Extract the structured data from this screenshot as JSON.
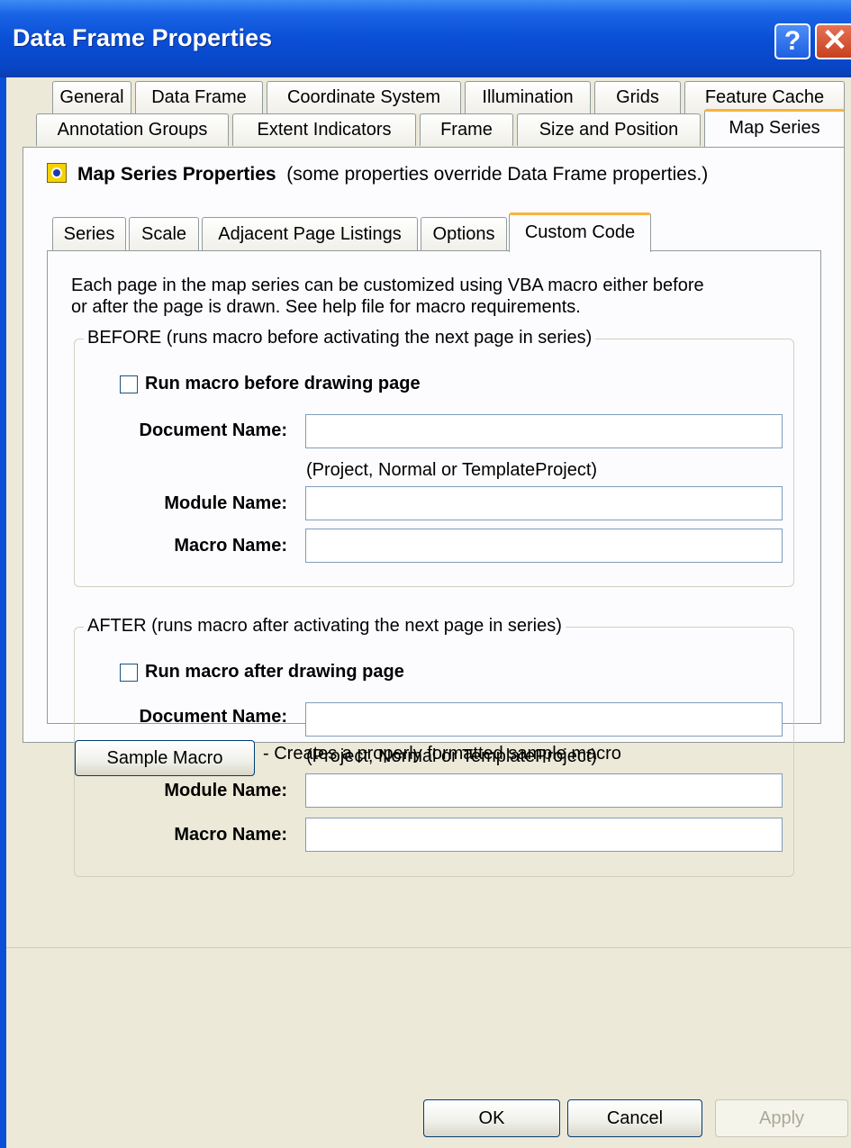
{
  "window": {
    "title": "Data Frame Properties",
    "help_glyph": "?",
    "close_glyph": "✕"
  },
  "outer_tabs": {
    "row1": [
      "General",
      "Data Frame",
      "Coordinate System",
      "Illumination",
      "Grids",
      "Feature Cache"
    ],
    "row2": [
      "Annotation Groups",
      "Extent Indicators",
      "Frame",
      "Size and Position",
      "Map Series"
    ],
    "active": "Map Series"
  },
  "panel": {
    "header_bold": "Map Series Properties",
    "header_note": "(some properties override Data Frame properties.)",
    "inner_tabs": [
      "Series",
      "Scale",
      "Adjacent Page Listings",
      "Options",
      "Custom Code"
    ],
    "inner_active": "Custom Code",
    "description_line1": "Each page in the map series can be customized using VBA macro either before",
    "description_line2": "or after the page is drawn. See help file for macro requirements."
  },
  "before": {
    "legend": "BEFORE (runs macro before activating the next page in series)",
    "checkbox_label": "Run macro before drawing page",
    "checked": false,
    "document_label": "Document Name:",
    "document_value": "",
    "document_hint": "(Project, Normal or TemplateProject)",
    "module_label": "Module Name:",
    "module_value": "",
    "macro_label": "Macro Name:",
    "macro_value": ""
  },
  "after": {
    "legend": "AFTER (runs macro after activating the next page in series)",
    "checkbox_label": "Run macro after drawing page",
    "checked": false,
    "document_label": "Document Name:",
    "document_value": "",
    "document_hint": "(Project, Normal or TemplateProject)",
    "module_label": "Module Name:",
    "module_value": "",
    "macro_label": "Macro Name:",
    "macro_value": ""
  },
  "sample": {
    "button_label": "Sample Macro",
    "note": "- Creates a properly formatted sample macro"
  },
  "footer": {
    "ok_label": "OK",
    "cancel_label": "Cancel",
    "apply_label": "Apply",
    "apply_enabled": false
  },
  "colors": {
    "title_bar": "#0a4fd6",
    "active_tab_accent": "#f8b33c",
    "dialog_face": "#ece9d8"
  }
}
